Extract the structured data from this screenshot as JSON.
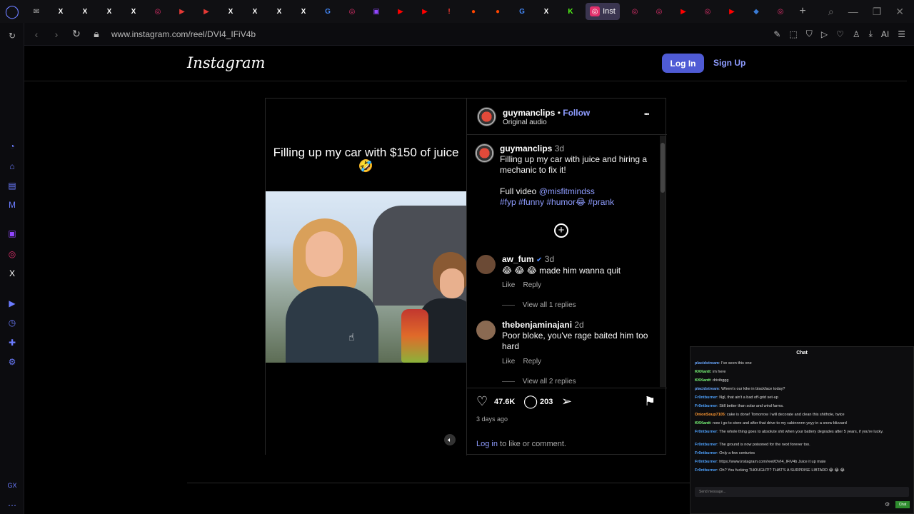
{
  "browser": {
    "tabs": [
      {
        "icon": "mail-icon",
        "glyph": "✉",
        "color": "#bbbbbb"
      },
      {
        "icon": "x-icon",
        "glyph": "X",
        "color": "#ffffff"
      },
      {
        "icon": "x-icon",
        "glyph": "X",
        "color": "#ffffff"
      },
      {
        "icon": "x-icon",
        "glyph": "X",
        "color": "#ffffff"
      },
      {
        "icon": "x-icon",
        "glyph": "X",
        "color": "#ffffff"
      },
      {
        "icon": "instagram-icon",
        "glyph": "◎",
        "color": "#e1306c"
      },
      {
        "icon": "play-icon",
        "glyph": "▶",
        "color": "#e53935"
      },
      {
        "icon": "play-icon",
        "glyph": "▶",
        "color": "#e53935"
      },
      {
        "icon": "x-icon",
        "glyph": "X",
        "color": "#ffffff"
      },
      {
        "icon": "x-icon",
        "glyph": "X",
        "color": "#ffffff"
      },
      {
        "icon": "x-icon",
        "glyph": "X",
        "color": "#ffffff"
      },
      {
        "icon": "x-icon",
        "glyph": "X",
        "color": "#ffffff"
      },
      {
        "icon": "google-icon",
        "glyph": "G",
        "color": "#4285f4"
      },
      {
        "icon": "instagram-icon",
        "glyph": "◎",
        "color": "#e1306c"
      },
      {
        "icon": "twitch-icon",
        "glyph": "▣",
        "color": "#9146ff"
      },
      {
        "icon": "youtube-icon",
        "glyph": "▶",
        "color": "#ff0000"
      },
      {
        "icon": "youtube-icon",
        "glyph": "▶",
        "color": "#ff0000"
      },
      {
        "icon": "alert-icon",
        "glyph": "!",
        "color": "#ff3b30"
      },
      {
        "icon": "reddit-icon",
        "glyph": "●",
        "color": "#ff4500"
      },
      {
        "icon": "reddit-icon",
        "glyph": "●",
        "color": "#ff4500"
      },
      {
        "icon": "google-icon",
        "glyph": "G",
        "color": "#4285f4"
      },
      {
        "icon": "x-icon",
        "glyph": "X",
        "color": "#ffffff"
      },
      {
        "icon": "kick-icon",
        "glyph": "K",
        "color": "#53fc18"
      }
    ],
    "active_tab": {
      "label": "Inst",
      "icon": "instagram-icon"
    },
    "tabs_after": [
      {
        "icon": "instagram-icon",
        "glyph": "◎",
        "color": "#e1306c"
      },
      {
        "icon": "instagram-icon",
        "glyph": "◎",
        "color": "#e1306c"
      },
      {
        "icon": "youtube-icon",
        "glyph": "▶",
        "color": "#ff0000"
      },
      {
        "icon": "instagram-icon",
        "glyph": "◎",
        "color": "#e1306c"
      },
      {
        "icon": "youtube-icon",
        "glyph": "▶",
        "color": "#ff0000"
      },
      {
        "icon": "app-icon",
        "glyph": "◆",
        "color": "#3a7bd5"
      },
      {
        "icon": "instagram-icon",
        "glyph": "◎",
        "color": "#e1306c"
      }
    ],
    "url": "www.instagram.com/reel/DVI4_IFiV4b",
    "ai_label": "AI"
  },
  "sidebar": {
    "bottom_label": "GX"
  },
  "instagram": {
    "logo": "Instagram",
    "login_label": "Log In",
    "signup_label": "Sign Up",
    "post": {
      "video_caption": "Filling up my car with $150 of juice 🤣",
      "author": "guymanclips",
      "follow_label": "Follow",
      "dot": "•",
      "audio": "Original audio",
      "more_label": "•••",
      "caption_user": "guymanclips",
      "caption_time": "3d",
      "caption_text": "Filling up my car with juice and hiring a mechanic to fix it!",
      "caption_fullvideo": "Full video",
      "caption_mention": "@misfitmindss",
      "caption_tags": "#fyp #funny #humor😂 #prank",
      "comments": [
        {
          "user": "aw_fum",
          "verified": true,
          "time": "3d",
          "text": "😂 😂 😂 made him wanna quit",
          "like": "Like",
          "reply": "Reply",
          "replies": "View all 1 replies"
        },
        {
          "user": "thebenjaminajani",
          "verified": false,
          "time": "2d",
          "text": "Poor bloke, you've rage baited him too hard",
          "like": "Like",
          "reply": "Reply",
          "replies": "View all 2 replies"
        }
      ],
      "likes": "47.6K",
      "comment_count": "203",
      "posted": "3 days ago",
      "login_link": "Log in",
      "login_prompt": "to like or comment."
    }
  },
  "chat": {
    "title": "Chat",
    "messages": [
      {
        "user": "placidstream",
        "color": "#6aa8ff",
        "text": "I've seen this one"
      },
      {
        "user": "KKKantt",
        "color": "#7cff7c",
        "text": "im here"
      },
      {
        "user": "KKKantt",
        "color": "#7cff7c",
        "text": "drivibggg"
      },
      {
        "user": "placidstream",
        "color": "#6aa8ff",
        "text": "Where's our kike in blackface today?"
      },
      {
        "user": "Fr0ntburner",
        "color": "#4fa3ff",
        "text": "Ngl, that ain't a bad off-grid set-up"
      },
      {
        "user": "Fr0ntburner",
        "color": "#4fa3ff",
        "text": "Still better than solar and wind farms."
      },
      {
        "user": "OnionSoup7105",
        "color": "#ff9933",
        "text": "cake is done! Tomorrow I will decorate and clean this shithole, twice"
      },
      {
        "user": "KKKantt",
        "color": "#7cff7c",
        "text": "now i go to store and after that drive to my cabinnnnn yeyy in a snow blizzard"
      },
      {
        "user": "Fr0ntburner",
        "color": "#4fa3ff",
        "text": "The whole thing goes to absolute shit when your battery degrades after 5 years, if you're lucky."
      },
      {
        "user": "Fr0ntburner",
        "color": "#4fa3ff",
        "text": "The ground is now poisoned for the next forever too."
      },
      {
        "user": "Fr0ntburner",
        "color": "#4fa3ff",
        "text": "Only a few centuries"
      },
      {
        "user": "Fr0ntburner",
        "color": "#4fa3ff",
        "text": "https://www.instagram.com/reel/DVI4_IFiV4b Juice it up mate"
      },
      {
        "user": "Fr0ntburner",
        "color": "#4fa3ff",
        "text": "Oh? You fucking THOUGHT!? THAT'S A SURPRISE LIBTARD 😂 😂 😂"
      }
    ],
    "input_placeholder": "Send message...",
    "send_label": "Chat"
  }
}
